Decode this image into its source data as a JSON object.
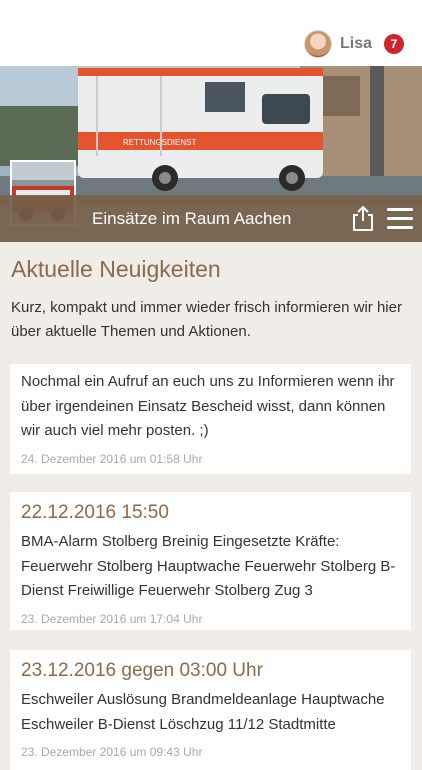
{
  "user": {
    "name": "Lisa",
    "notification_count": "7"
  },
  "header": {
    "title": "Einsätze im Raum Aachen",
    "vehicle_text": "RETTUNGSDIENST"
  },
  "page": {
    "heading": "Aktuelle Neuigkeiten",
    "intro": "Kurz, kompakt und immer wieder frisch informieren wir hier über aktuelle Themen und Aktionen."
  },
  "posts": [
    {
      "title": "",
      "body": "Nochmal ein Aufruf an euch uns zu Informieren wenn ihr über irgendeinen Einsatz Bescheid wisst, dann können wir auch viel mehr posten. ;)",
      "date": "24. Dezember 2016 um 01:58 Uhr"
    },
    {
      "title": "22.12.2016 15:50",
      "body": "BMA-Alarm Stolberg Breinig Eingesetzte Kräfte: Feuerwehr Stolberg Hauptwache Feuerwehr Stolberg B-Dienst Freiwillige Feuerwehr Stolberg Zug 3",
      "date": "23. Dezember 2016 um 17:04 Uhr"
    },
    {
      "title": "23.12.2016 gegen 03:00 Uhr",
      "body": "Eschweiler Auslösung Brandmeldeanlage Hauptwache Eschweiler B-Dienst Löschzug 11/12 Stadtmitte",
      "date": "23. Dezember 2016 um 09:43 Uhr"
    }
  ],
  "colors": {
    "accent": "#8b6a4c",
    "bar": "#765f49",
    "badge": "#d0262b",
    "background": "#f0ece7"
  }
}
